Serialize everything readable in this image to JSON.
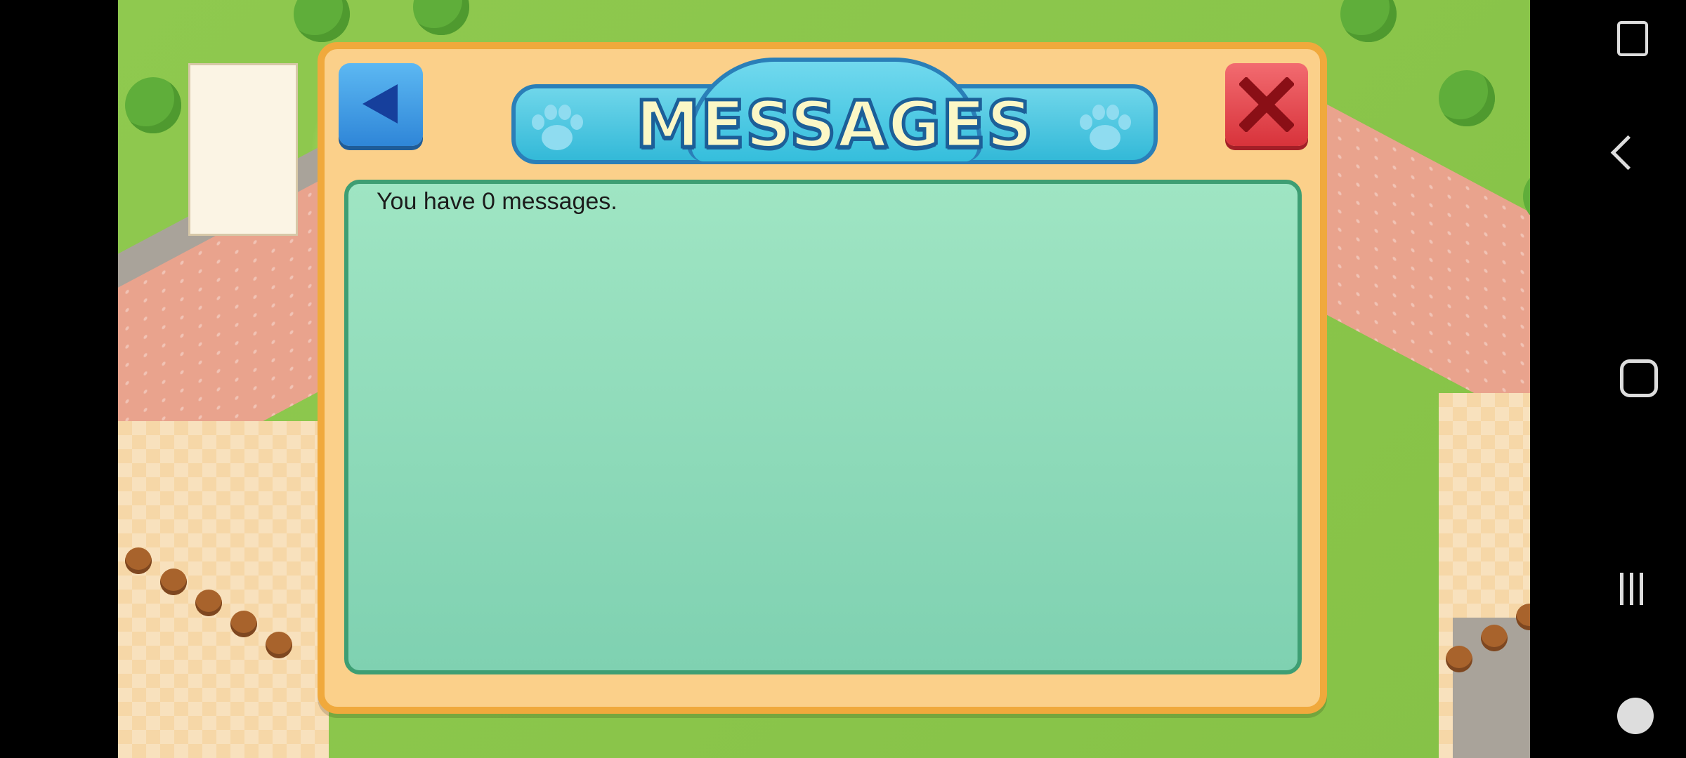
{
  "dialog": {
    "title": "MESSAGES",
    "message": "You have 0 messages.",
    "back_icon": "left-triangle-icon",
    "close_icon": "x-icon"
  },
  "navbar": {
    "icons": [
      "rotate-screen-icon",
      "back-icon",
      "home-icon",
      "recents-icon",
      "game-tools-icon"
    ]
  },
  "colors": {
    "dialog_bg": "#fbd08a",
    "dialog_border": "#f0a93c",
    "panel_bg": "#8fdcb9",
    "title_banner": "#4cc7e0",
    "close_button": "#e0414a",
    "back_button": "#3f9ae3"
  }
}
